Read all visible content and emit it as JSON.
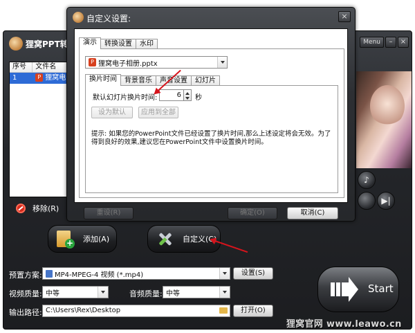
{
  "app": {
    "title": "狸窝PPT转换",
    "menu_label": "Menu",
    "minimize": "–",
    "close": "×",
    "file_list": {
      "headers": [
        "序号",
        "文件名"
      ],
      "rows": [
        {
          "index": "1",
          "name": "狸窝电子相册.pptx"
        }
      ]
    },
    "remove_label": "移除(R)",
    "preview_controls": {
      "volume": "♪",
      "play": "▶|"
    }
  },
  "dialog": {
    "title": "自定义设置:",
    "close": "×",
    "top_tabs": [
      "演示",
      "转换设置",
      "水印"
    ],
    "file_select": "狸窝电子相册.pptx",
    "inner_tabs": [
      "换片时间",
      "背景音乐",
      "声音设置",
      "幻灯片"
    ],
    "slide_time_label": "默认幻灯片换片时间:",
    "slide_time_value": "6",
    "slide_time_unit": "秒",
    "set_default": "设为默认",
    "apply_all": "应用到全部",
    "tip": "提示: 如果您的PowerPoint文件已经设置了换片时间,那么上述设定将会无效。为了得到良好的效果,建议您在PowerPoint文件中设置换片时间。",
    "reset": "重设(R)",
    "ok": "确定(O)",
    "cancel": "取消(C)"
  },
  "toolbar": {
    "add_label": "添加(A)",
    "custom_label": "自定义(C)"
  },
  "settings": {
    "preset_label": "预置方案:",
    "preset_value": "MP4-MPEG-4 视频 (*.mp4)",
    "settings_button": "设置(S)",
    "video_quality_label": "视频质量:",
    "video_quality_value": "中等",
    "audio_quality_label": "音频质量:",
    "audio_quality_value": "中等",
    "output_label": "输出路径:",
    "output_value": "C:\\Users\\Rex\\Desktop",
    "open_button": "打开(O)"
  },
  "start_label": "Start",
  "watermark": "狸窝官网 www.leawo.cn",
  "colors": {
    "annotation": "#d6141c",
    "selection": "#2e6bd6"
  }
}
